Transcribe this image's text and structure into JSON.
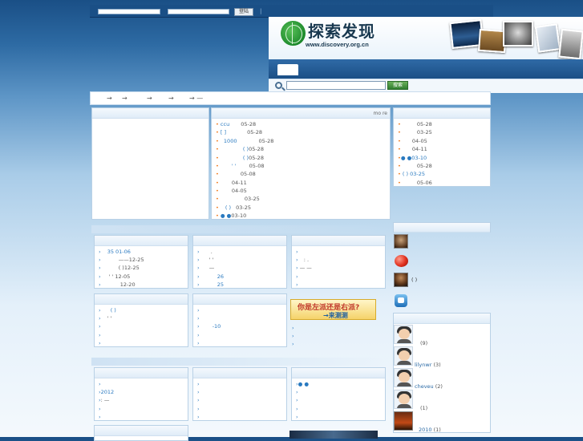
{
  "topbar": {
    "login_label": "登陆",
    "sep": "|"
  },
  "header": {
    "logo_text": "探索发现",
    "logo_url": "www.discovery.org.cn",
    "search_placeholder": "",
    "search_btn": "搜索"
  },
  "breadcrumb": {
    "items": [
      "→",
      "→",
      "→",
      "→",
      "→ —"
    ]
  },
  "news": {
    "more": "mo re",
    "rows": [
      {
        "text": "ccu",
        "date": "05-28"
      },
      {
        "text": "[ ]",
        "date": "05-28"
      },
      {
        "text": "1000",
        "date": "05-28"
      },
      {
        "text": "( )",
        "date": "05-28"
      },
      {
        "text": "( )",
        "date": "05-28"
      },
      {
        "text": "' '",
        "date": "05-08"
      },
      {
        "text": "",
        "date": "05-08"
      },
      {
        "text": "",
        "date": "04-11"
      },
      {
        "text": "",
        "date": "04-05"
      },
      {
        "text": "",
        "date": "03-25"
      },
      {
        "text": "( )",
        "date": "03-25"
      },
      {
        "text": "●   ●",
        "date": "03-10"
      }
    ]
  },
  "rightlist": {
    "rows": [
      "05-28",
      "03-25",
      "04-05",
      "04-11",
      "●   ●03-10",
      "05-28",
      "( )  03-25",
      "05-06"
    ]
  },
  "sec2": {
    "p1": [
      "35    01-06",
      "——12-25",
      "( )12-25",
      "' '  12-05",
      "12-20"
    ],
    "p2": [
      ".",
      "' '",
      "—",
      "26",
      "25"
    ],
    "p3": [
      "",
      ":   .",
      "—   —",
      "",
      ""
    ],
    "p4": [
      "( )",
      "' '",
      "",
      "",
      ""
    ],
    "p5": [
      "",
      "",
      "-10",
      "",
      ""
    ],
    "banner_line1": "你是左派还是右派?",
    "banner_line2": "→来测测",
    "p6": [
      "",
      "",
      ""
    ]
  },
  "sec3": {
    "p1": [
      "",
      "2012",
      ":   —",
      "",
      ""
    ],
    "p2": [
      "",
      "",
      "",
      "",
      ""
    ],
    "p3": [
      "●   ●",
      "",
      "",
      "",
      ""
    ]
  },
  "sidebar": {
    "icons": [
      "",
      "",
      "( )",
      ""
    ],
    "users": [
      {
        "name": "",
        "count": "(9)"
      },
      {
        "name": "lilynwr",
        "count": "(3)"
      },
      {
        "name": "cheveu",
        "count": "(2)"
      },
      {
        "name": "",
        "count": "(1)"
      },
      {
        "name": "2010",
        "count": "(1)"
      }
    ]
  }
}
